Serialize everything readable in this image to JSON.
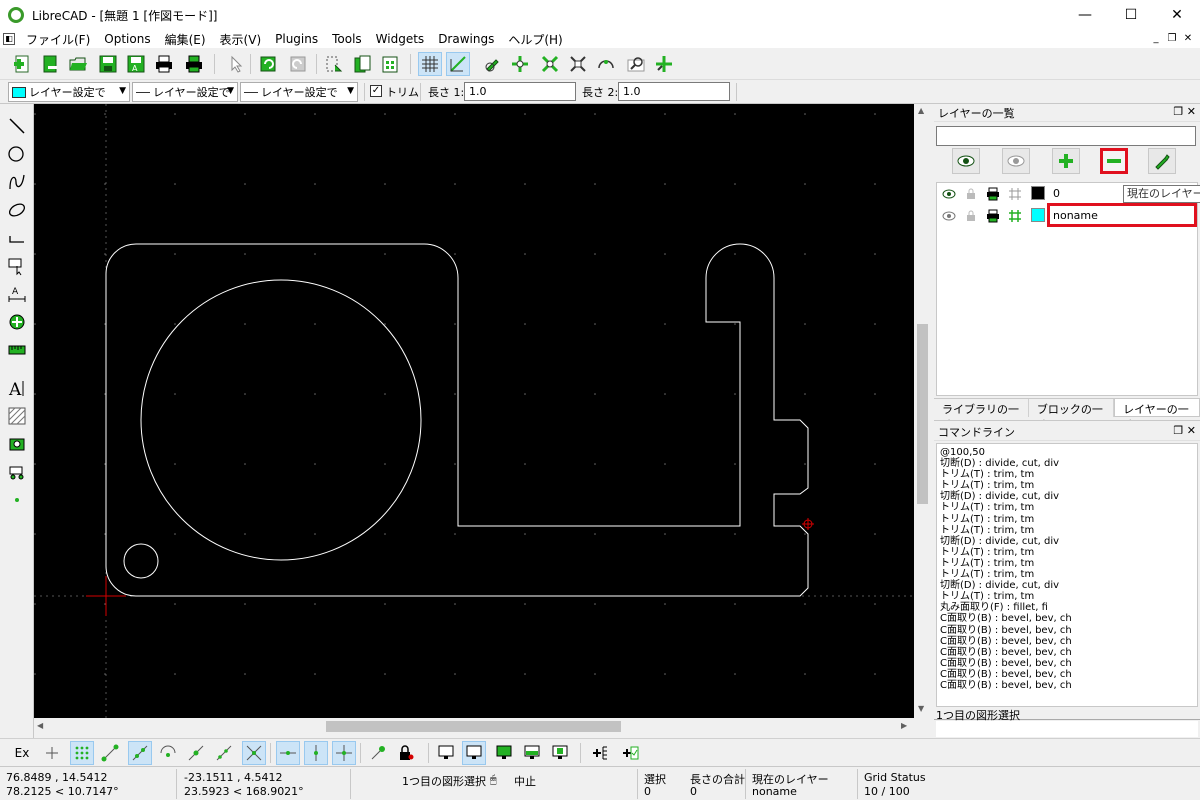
{
  "window": {
    "title": "LibreCAD - [無題 1 [作図モード]]",
    "min_label": "—",
    "max_label": "☐",
    "close_label": "✕"
  },
  "menu": {
    "items": [
      "ファイル(F)",
      "Options",
      "編集(E)",
      "表示(V)",
      "Plugins",
      "Tools",
      "Widgets",
      "Drawings",
      "ヘルプ(H)"
    ]
  },
  "pen_toolbar": {
    "color": "レイヤー設定で",
    "width": "レイヤー設定で",
    "type": "レイヤー設定で",
    "trim_label": "トリム",
    "trim_checked": true,
    "length1_label": "長さ 1:",
    "length1_value": "1.0",
    "length2_label": "長さ 2:",
    "length2_value": "1.0"
  },
  "layer_panel": {
    "title": "レイヤーの一覧",
    "filter_value": "",
    "layers": [
      {
        "name": "0",
        "color": "#000000",
        "visible": true
      },
      {
        "name": "noname",
        "color": "#00ffff",
        "visible": true
      }
    ],
    "tooltip": "現在のレイヤー削除",
    "tabs": [
      "ライブラリの一覧",
      "ブロックの一覧",
      "レイヤーの一覧"
    ],
    "active_tab": 2
  },
  "command_panel": {
    "title": "コマンドライン",
    "history": [
      "@100,50",
      "切断(D) : divide, cut, div",
      "トリム(T) : trim, tm",
      "トリム(T) : trim, tm",
      "切断(D) : divide, cut, div",
      "トリム(T) : trim, tm",
      "トリム(T) : trim, tm",
      "トリム(T) : trim, tm",
      "切断(D) : divide, cut, div",
      "トリム(T) : trim, tm",
      "トリム(T) : trim, tm",
      "トリム(T) : trim, tm",
      "切断(D) : divide, cut, div",
      "トリム(T) : trim, tm",
      "丸み面取り(F) : fillet, fi",
      "C面取り(B) : bevel, bev, ch",
      "C面取り(B) : bevel, bev, ch",
      "C面取り(B) : bevel, bev, ch",
      "C面取り(B) : bevel, bev, ch",
      "C面取り(B) : bevel, bev, ch",
      "C面取り(B) : bevel, bev, ch",
      "C面取り(B) : bevel, bev, ch"
    ],
    "prompt": "1つ目の図形選択"
  },
  "snap_toolbar": {
    "ex_label": "Ex"
  },
  "status": {
    "abs_coord": "76.8489 , 14.5412",
    "abs_polar": "78.2125 < 10.7147°",
    "rel_coord": "-23.1511 , 4.5412",
    "rel_polar": "23.5923 < 168.9021°",
    "action_hint": "1つ目の図形選択",
    "mouse_right": "中止",
    "selected_label": "選択",
    "selected_value": "0",
    "total_length_label": "長さの合計",
    "total_length_value": "0",
    "current_layer_label": "現在のレイヤー",
    "current_layer_value": "noname",
    "grid_label": "Grid Status",
    "grid_value": "10 / 100"
  }
}
